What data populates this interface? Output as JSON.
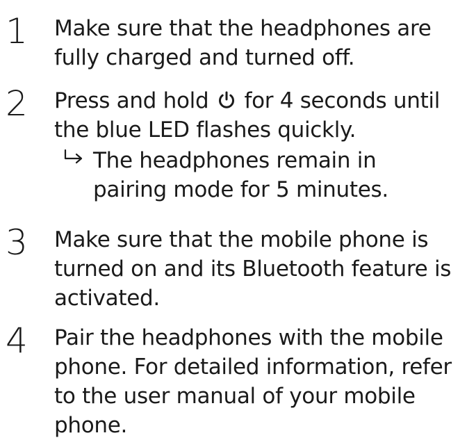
{
  "steps": [
    {
      "number": "1",
      "text": "Make sure that the headphones are fully charged and turned off."
    },
    {
      "number": "2",
      "text_before": "Press and hold",
      "text_after": "for 4 seconds until the blue LED flashes quickly.",
      "icon": "power-icon"
    },
    {
      "number": "3",
      "text": "Make sure that the mobile phone is turned on and its Bluetooth feature is activated."
    },
    {
      "number": "4",
      "text": "Pair the headphones with the mobile phone. For detailed information, refer to the user manual of your mobile phone."
    }
  ],
  "result": {
    "icon": "result-arrow-icon",
    "text": "The headphones remain in pairing mode for 5 minutes."
  }
}
